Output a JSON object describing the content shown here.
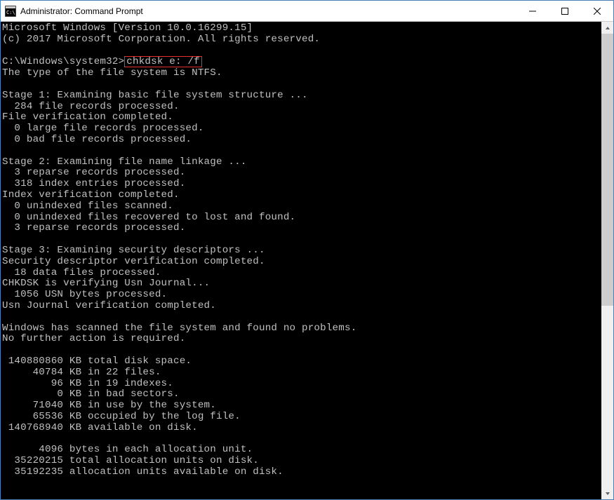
{
  "window": {
    "title": "Administrator: Command Prompt"
  },
  "terminal": {
    "header_line1": "Microsoft Windows [Version 10.0.16299.15]",
    "header_line2": "(c) 2017 Microsoft Corporation. All rights reserved.",
    "prompt": "C:\\Windows\\system32>",
    "command": "chkdsk e: /f",
    "fs_type": "The type of the file system is NTFS.",
    "stage1_title": "Stage 1: Examining basic file system structure ...",
    "stage1_l1": "  284 file records processed.",
    "stage1_l2": "File verification completed.",
    "stage1_l3": "  0 large file records processed.",
    "stage1_l4": "  0 bad file records processed.",
    "stage2_title": "Stage 2: Examining file name linkage ...",
    "stage2_l1": "  3 reparse records processed.",
    "stage2_l2": "  318 index entries processed.",
    "stage2_l3": "Index verification completed.",
    "stage2_l4": "  0 unindexed files scanned.",
    "stage2_l5": "  0 unindexed files recovered to lost and found.",
    "stage2_l6": "  3 reparse records processed.",
    "stage3_title": "Stage 3: Examining security descriptors ...",
    "stage3_l1": "Security descriptor verification completed.",
    "stage3_l2": "  18 data files processed.",
    "stage3_l3": "CHKDSK is verifying Usn Journal...",
    "stage3_l4": "  1056 USN bytes processed.",
    "stage3_l5": "Usn Journal verification completed.",
    "result_l1": "Windows has scanned the file system and found no problems.",
    "result_l2": "No further action is required.",
    "stats_l1": " 140880860 KB total disk space.",
    "stats_l2": "     40784 KB in 22 files.",
    "stats_l3": "        96 KB in 19 indexes.",
    "stats_l4": "         0 KB in bad sectors.",
    "stats_l5": "     71040 KB in use by the system.",
    "stats_l6": "     65536 KB occupied by the log file.",
    "stats_l7": " 140768940 KB available on disk.",
    "alloc_l1": "      4096 bytes in each allocation unit.",
    "alloc_l2": "  35220215 total allocation units on disk.",
    "alloc_l3": "  35192235 allocation units available on disk."
  }
}
